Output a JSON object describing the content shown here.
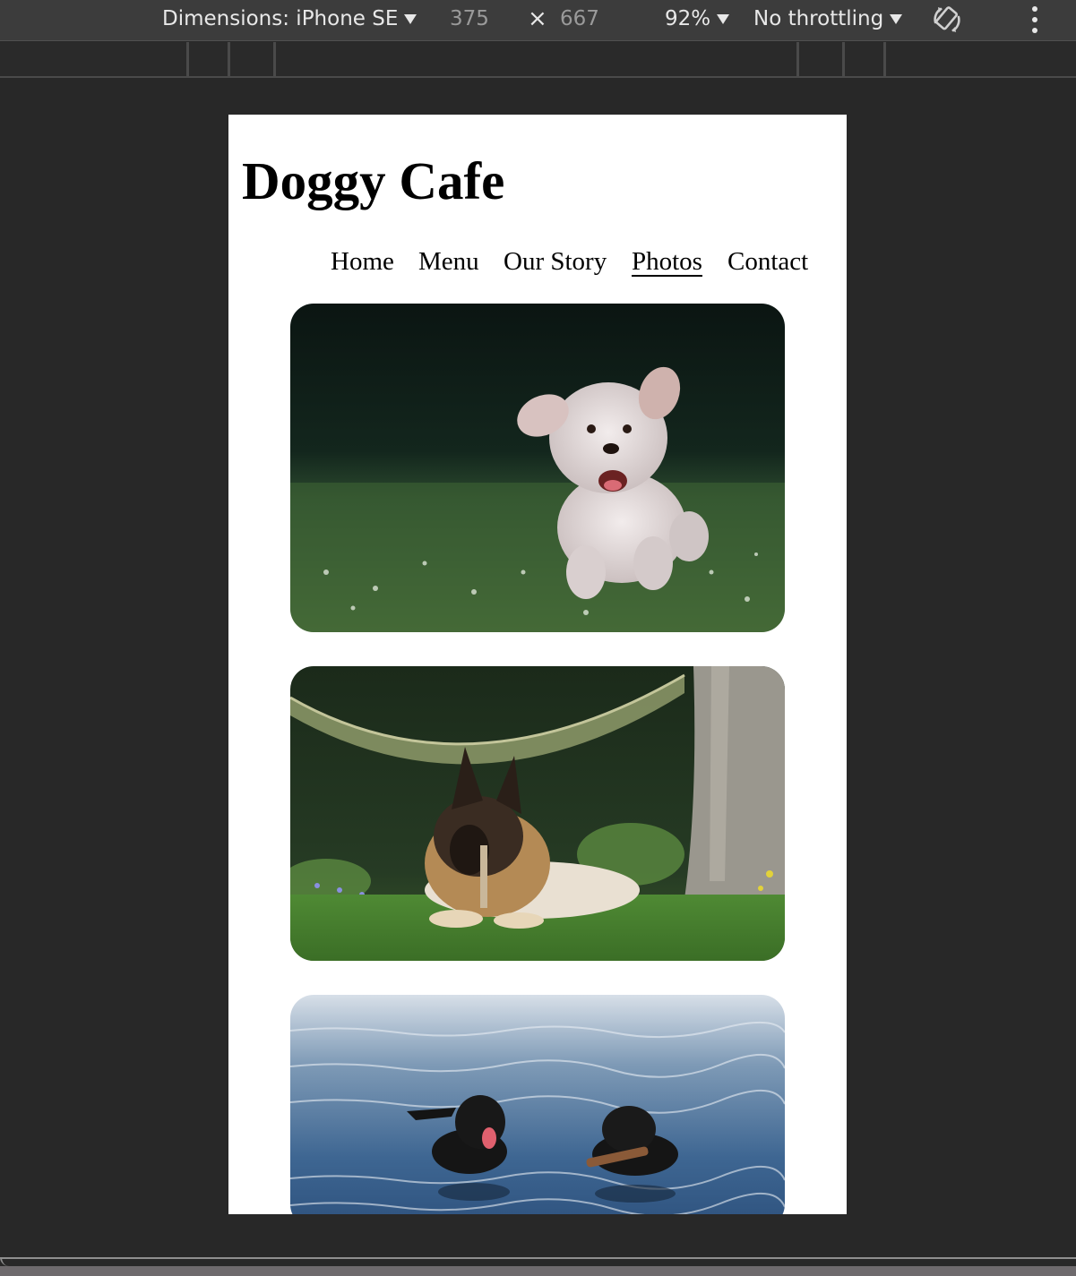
{
  "toolbar": {
    "dimensions_label": "Dimensions: iPhone SE",
    "width": "375",
    "times": "×",
    "height": "667",
    "zoom": "92%",
    "throttling": "No throttling",
    "rotate_icon": "rotate-icon",
    "more_icon": "kebab-menu-icon"
  },
  "site": {
    "title": "Doggy Cafe",
    "nav": [
      {
        "label": "Home",
        "active": false
      },
      {
        "label": "Menu",
        "active": false
      },
      {
        "label": "Our Story",
        "active": false
      },
      {
        "label": "Photos",
        "active": true
      },
      {
        "label": "Contact",
        "active": false
      }
    ],
    "photos": [
      {
        "subject": "fluffy white dog running on grass"
      },
      {
        "subject": "long-haired shepherd dog lying on grass under hammock"
      },
      {
        "subject": "two black dogs swimming in water"
      }
    ]
  },
  "colors": {
    "devtools_bg": "#3c3c3c",
    "page_bg": "#282828",
    "viewport_bg": "#ffffff"
  }
}
